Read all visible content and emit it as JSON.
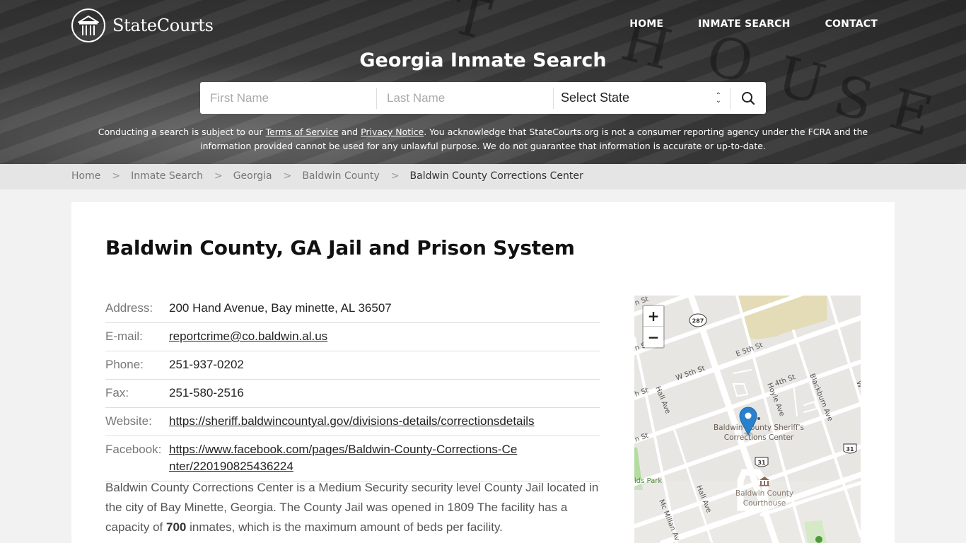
{
  "header": {
    "logo_text": "StateCourts",
    "nav": [
      {
        "label": "HOME"
      },
      {
        "label": "INMATE SEARCH"
      },
      {
        "label": "CONTACT"
      }
    ],
    "hero_title": "Georgia Inmate Search",
    "search": {
      "first_name_placeholder": "First Name",
      "last_name_placeholder": "Last Name",
      "state_selected": "Select State",
      "search_icon": "search-icon"
    },
    "disclaimer": {
      "part1": "Conducting a search is subject to our ",
      "terms_link": "Terms of Service",
      "part2": " and ",
      "privacy_link": "Privacy Notice",
      "part3": ". You acknowledge that StateCourts.org is not a consumer reporting agency under the FCRA and the information provided cannot be used for any unlawful purpose. We do not guarantee that information is accurate or up-to-date."
    },
    "bg_letters": [
      "T",
      "H",
      "O",
      "U",
      "S",
      "E"
    ]
  },
  "breadcrumb": [
    {
      "label": "Home"
    },
    {
      "label": "Inmate Search"
    },
    {
      "label": "Georgia"
    },
    {
      "label": "Baldwin County"
    },
    {
      "label": "Baldwin County Corrections Center"
    }
  ],
  "breadcrumb_separator": ">",
  "main": {
    "title": "Baldwin County, GA Jail and Prison System",
    "info": [
      {
        "label": "Address:",
        "value": "200 Hand Avenue, Bay minette, AL 36507",
        "link": false
      },
      {
        "label": "E-mail:",
        "value": "reportcrime@co.baldwin.al.us",
        "link": true
      },
      {
        "label": "Phone:",
        "value": "251-937-0202",
        "link": false
      },
      {
        "label": "Fax:",
        "value": "251-580-2516",
        "link": false
      },
      {
        "label": "Website:",
        "value": "https://sheriff.baldwincountyal.gov/divisions-details/correctionsdetails",
        "link": true
      },
      {
        "label": "Facebook:",
        "value": "https://www.facebook.com/pages/Baldwin-County-Corrections-Center/220190825436224",
        "link": true
      }
    ],
    "description": {
      "part1": "Baldwin County Corrections Center is a Medium Security security level County Jail located in the city of Bay Minette, Georgia. The County Jail was opened in 1809 The facility has a capacity of ",
      "capacity": "700",
      "part2": " inmates, which is the maximum amount of beds per facility."
    }
  },
  "map": {
    "zoom_in": "+",
    "zoom_out": "−",
    "labels": {
      "st_top": "n St",
      "st_mid": "n St",
      "st_left1": "h St",
      "st_left2": "n St",
      "e5th": "E 5th St",
      "w5th": "W 5th St",
      "4th": "4th St",
      "hall_ave": "Hall Ave",
      "hall_ave2": "Hall Ave",
      "hoyle_ave": "Hoyle Ave",
      "blackburn_ave": "Blackburn Ave",
      "mcmillan": "Mc Millan Av",
      "park": "ids Park",
      "poi_jail_1": "Baldwin County Sheriff's",
      "poi_jail_2": "Corrections Center",
      "poi_court_1": "Baldwin County",
      "poi_court_2": "Courthouse",
      "route_287": "287",
      "route_31a": "31",
      "route_31b": "31",
      "w_edge": "W"
    }
  }
}
